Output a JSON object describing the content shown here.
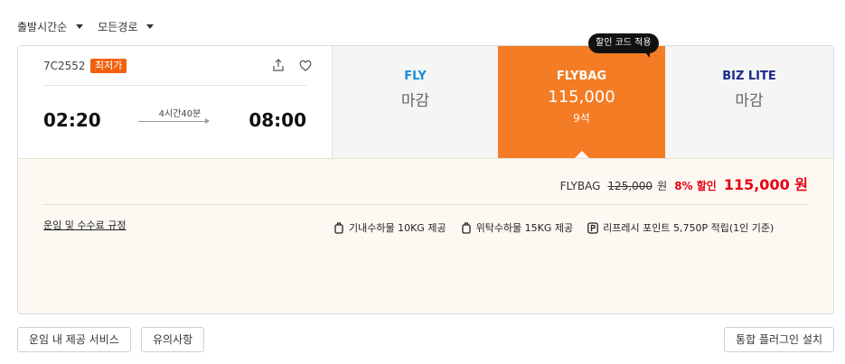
{
  "sort": {
    "time_label": "출발시간순",
    "route_label": "모든경로"
  },
  "flight": {
    "number": "7C2552",
    "badge": "최저가",
    "departure": "02:20",
    "arrival": "08:00",
    "duration": "4시간40분"
  },
  "fares": {
    "tooltip": "할인 코드 적용",
    "fly": {
      "name": "FLY",
      "status": "마감"
    },
    "flybag": {
      "name": "FLYBAG",
      "price": "115,000",
      "seats": "9석"
    },
    "bizlite": {
      "name": "BIZ LITE",
      "status": "마감"
    }
  },
  "detail": {
    "fare_name": "FLYBAG",
    "original_price": "125,000",
    "won": "원",
    "discount": "8% 할인",
    "final_price": "115,000 원",
    "rules_link": "운임 및 수수료 규정",
    "benefits": [
      "기내수하물 10KG 제공",
      "위탁수하물 15KG 제공",
      "리프레시 포인트 5,750P 적립(1인 기준)"
    ]
  },
  "footer": {
    "services_button": "운임 내 제공 서비스",
    "notes_button": "유의사항",
    "plugin_button": "통합 플러그인 설치"
  },
  "colors": {
    "accent": "#f37c24",
    "discount_red": "#e60012",
    "fly_blue": "#1a8ed4",
    "biz_navy": "#1d2a8a",
    "badge": "#f2600f"
  }
}
